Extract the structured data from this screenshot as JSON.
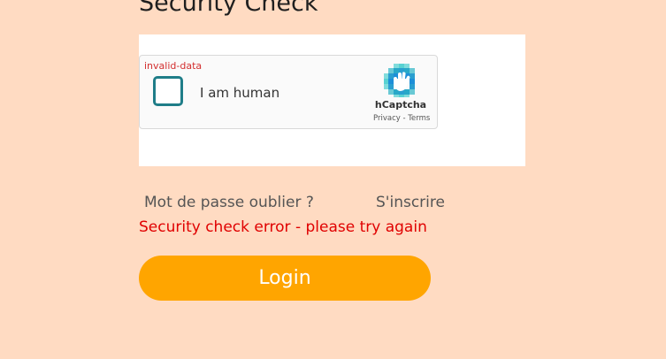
{
  "page": {
    "title": "Security Check"
  },
  "captcha": {
    "status_text": "invalid-data",
    "checkbox_label": "I am human",
    "brand_name": "hCaptcha",
    "privacy_link": "Privacy",
    "separator": " - ",
    "terms_link": "Terms"
  },
  "links": {
    "forgot_password": "Mot de passe oublier ?",
    "register": "S'inscrire"
  },
  "error": {
    "message": "Security check error - please try again"
  },
  "actions": {
    "login_label": "Login"
  },
  "colors": {
    "background": "#ffdbc2",
    "accent": "#ffa500",
    "error": "#e00000",
    "checkbox_border": "#1f7d88"
  },
  "icons": {
    "captcha_logo": "hcaptcha-logo-icon"
  }
}
